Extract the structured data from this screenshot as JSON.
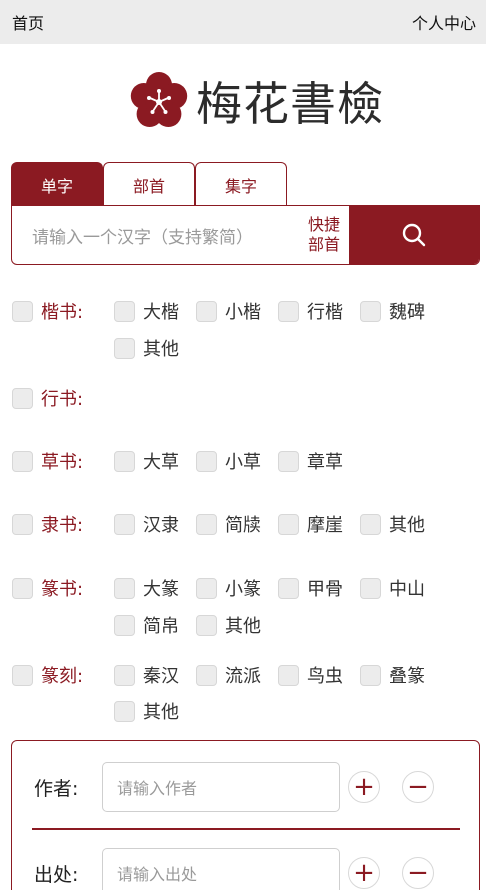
{
  "topbar": {
    "home": "首页",
    "user_center": "个人中心"
  },
  "logo": {
    "brand": "梅花書檢",
    "icon": "plum-blossom-icon"
  },
  "tabs": [
    {
      "label": "单字",
      "active": true
    },
    {
      "label": "部首",
      "active": false
    },
    {
      "label": "集字",
      "active": false
    }
  ],
  "search": {
    "placeholder": "请输入一个汉字（支持繁简）",
    "quick_line1": "快捷",
    "quick_line2": "部首",
    "button_icon": "search-icon"
  },
  "categories": [
    {
      "label": "楷书:",
      "options": [
        "大楷",
        "小楷",
        "行楷",
        "魏碑",
        "其他"
      ]
    },
    {
      "label": "行书:",
      "options": []
    },
    {
      "label": "草书:",
      "options": [
        "大草",
        "小草",
        "章草"
      ]
    },
    {
      "label": "隶书:",
      "options": [
        "汉隶",
        "简牍",
        "摩崖",
        "其他"
      ]
    },
    {
      "label": "篆书:",
      "options": [
        "大篆",
        "小篆",
        "甲骨",
        "中山",
        "简帛",
        "其他"
      ]
    },
    {
      "label": "篆刻:",
      "options": [
        "秦汉",
        "流派",
        "鸟虫",
        "叠篆",
        "其他"
      ]
    }
  ],
  "filters": {
    "author": {
      "label": "作者:",
      "placeholder": "请输入作者"
    },
    "source": {
      "label": "出处:",
      "placeholder": "请输入出处"
    },
    "add_symbol": "+",
    "remove_symbol": "−"
  },
  "colors": {
    "accent": "#8b1a22",
    "topbar": "#ececec",
    "checkbox": "#ececec"
  }
}
